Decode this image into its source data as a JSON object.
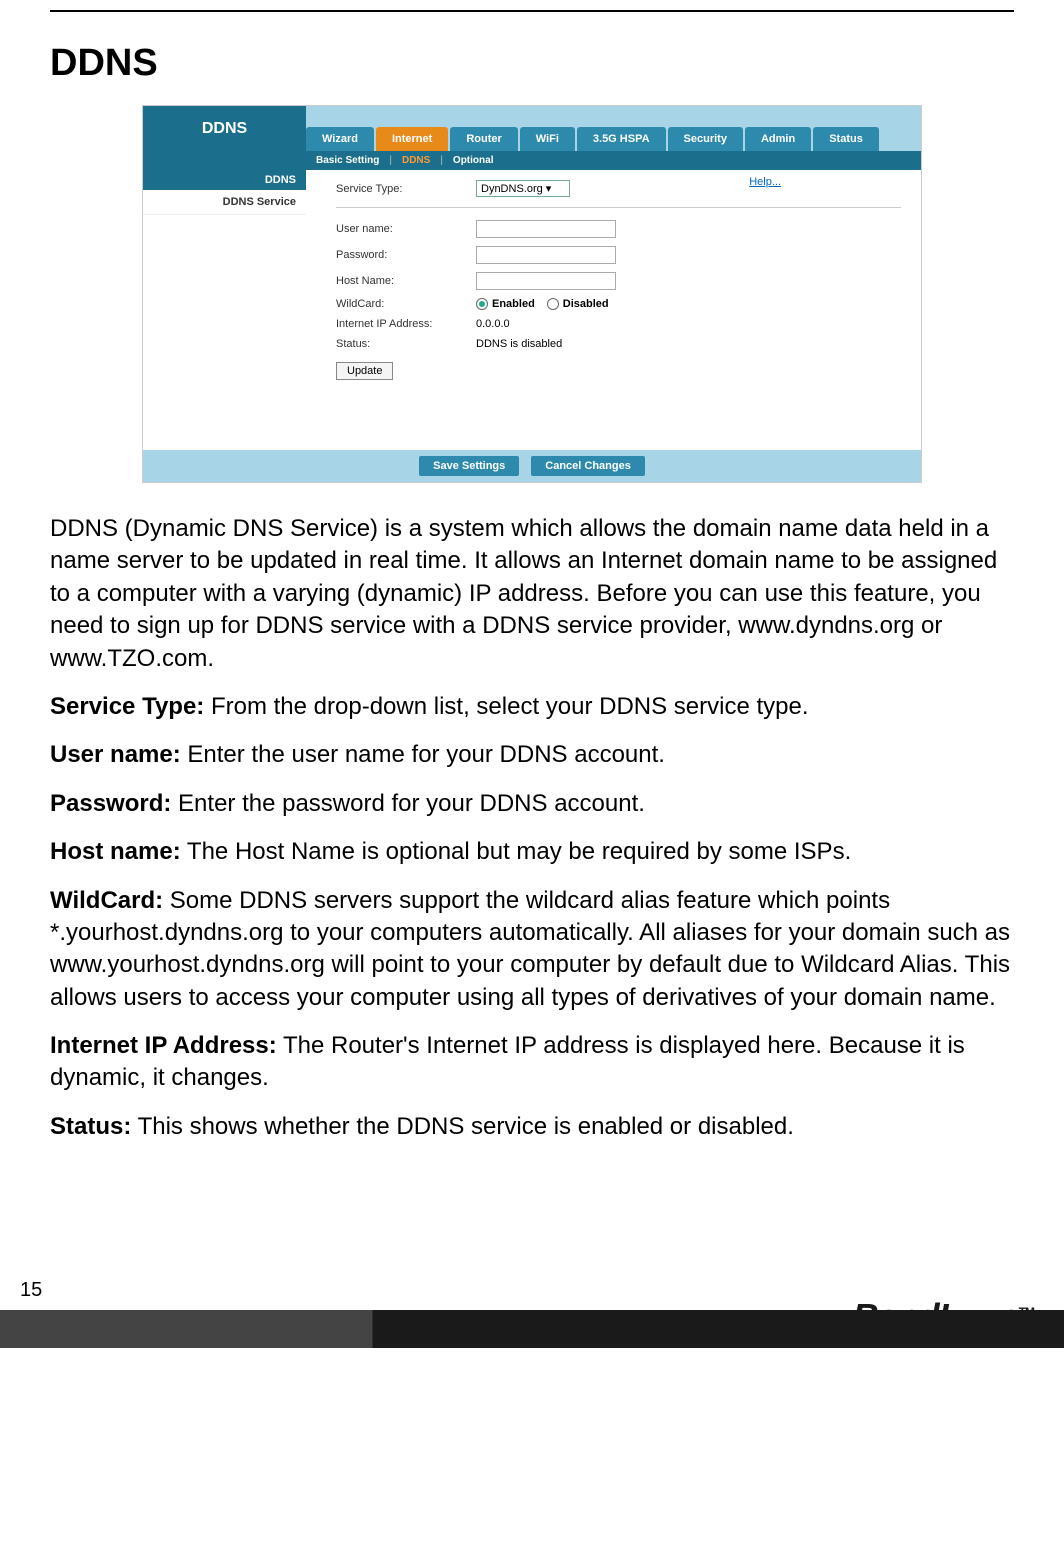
{
  "page_title": "DDNS",
  "screenshot": {
    "logo_title": "DDNS",
    "tabs": [
      {
        "label": "Wizard"
      },
      {
        "label": "Internet"
      },
      {
        "label": "Router"
      },
      {
        "label": "WiFi"
      },
      {
        "label": "3.5G HSPA"
      },
      {
        "label": "Security"
      },
      {
        "label": "Admin"
      },
      {
        "label": "Status"
      }
    ],
    "active_tab_index": 1,
    "subnav": {
      "basic": "Basic Setting",
      "ddns": "DDNS",
      "optional": "Optional"
    },
    "sidebar": {
      "head": "DDNS",
      "item": "DDNS Service"
    },
    "help_label": "Help...",
    "fields": {
      "service_type_label": "Service Type:",
      "service_type_value": "DynDNS.org",
      "user_name_label": "User name:",
      "password_label": "Password:",
      "host_name_label": "Host Name:",
      "wildcard_label": "WildCard:",
      "enabled_label": "Enabled",
      "disabled_label": "Disabled",
      "ip_label": "Internet IP Address:",
      "ip_value": "0.0.0.0",
      "status_label": "Status:",
      "status_value": "DDNS is disabled",
      "update_btn": "Update"
    },
    "footer": {
      "save": "Save Settings",
      "cancel": "Cancel Changes"
    }
  },
  "description": {
    "intro": "DDNS (Dynamic DNS Service) is a system which allows the domain name data held in a name server to be updated in real time. It allows an Internet domain name to be assigned to a computer with a varying (dynamic) IP address. Before you can use this feature, you need to sign up for DDNS service with a DDNS service provider, www.dyndns.org or www.TZO.com.",
    "service_type_label": "Service Type:",
    "service_type_text": " From the drop-down list, select your DDNS service type.",
    "user_name_label": "User name:",
    "user_name_text": " Enter the user name for your DDNS account.",
    "password_label": "Password:",
    "password_text": " Enter the password for your DDNS account.",
    "host_name_label": "Host name:",
    "host_name_text": " The Host Name is optional but may be required by some ISPs.",
    "wildcard_label": "WildCard:",
    "wildcard_text": " Some DDNS servers support the wildcard alias feature which points *.yourhost.dyndns.org to your computers automatically. All aliases for your domain such as www.yourhost.dyndns.org will point to your computer by default due to Wildcard Alias. This allows users to access your computer using all types of derivatives of your domain name.",
    "ip_label": "Internet IP Address:",
    "ip_text": " The Router's Internet IP address is displayed here. Because it is dynamic, it changes.",
    "status_label": "Status:",
    "status_text": " This shows whether the DDNS service is enabled or disabled."
  },
  "page_number": "15",
  "brand": "BandLuxe",
  "tm": "TM"
}
